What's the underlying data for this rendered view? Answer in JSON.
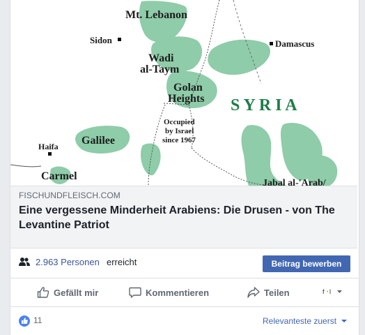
{
  "map": {
    "labels": {
      "mt_lebanon": "Mt. Lebanon",
      "sidon": "Sidon",
      "damascus": "Damascus",
      "wadi": "Wadi",
      "al_taym": "al-Taym",
      "golan": "Golan",
      "heights": "Heights",
      "syria": "S Y R I A",
      "occupied1": "Occupied",
      "occupied2": "by Israel",
      "occupied3": "since 1967",
      "haifa": "Haifa",
      "galilee": "Galilee",
      "carmel": "Carmel",
      "jabal": "Jabal al-'Arab/"
    }
  },
  "preview": {
    "domain": "FISCHUNDFLEISCH.COM",
    "headline": "Eine vergessene Minderheit Arabiens: Die Drusen - von The Levantine Patriot"
  },
  "reach": {
    "count": "2.963 Personen",
    "text": "erreicht",
    "boost_label": "Beitrag bewerben"
  },
  "actions": {
    "like": "Gefällt mir",
    "comment": "Kommentieren",
    "share": "Teilen"
  },
  "comments": {
    "like_count": "11",
    "sort_label": "Relevanteste zuerst"
  },
  "colors": {
    "accent": "#4267b2",
    "link": "#385898",
    "map_green": "#8fcca9"
  }
}
